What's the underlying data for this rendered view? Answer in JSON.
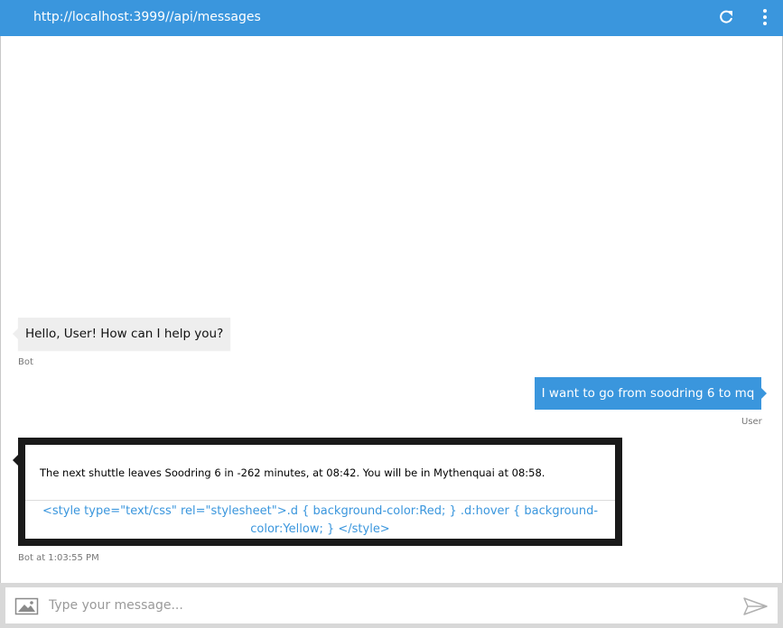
{
  "header": {
    "url": "http://localhost:3999//api/messages",
    "refresh_icon": "refresh-icon",
    "menu_icon": "more-vertical-icon"
  },
  "messages": [
    {
      "sender": "bot",
      "text": "Hello, User! How can I help you?",
      "meta": "Bot"
    },
    {
      "sender": "user",
      "text": "I want to go from soodring 6 to mq",
      "meta": "User"
    },
    {
      "sender": "bot",
      "card_text": "The next shuttle leaves Soodring 6 in -262 minutes, at 08:42. You will be in Mythenquai at 08:58.",
      "card_button": "<style type=\"text/css\" rel=\"stylesheet\">.d { background-color:Red; } .d:hover { background-color:Yellow; } </style>",
      "meta": "Bot at 1:03:55 PM"
    }
  ],
  "input": {
    "placeholder": "Type your message...",
    "value": "",
    "image_icon": "image-upload-icon",
    "send_icon": "send-icon"
  },
  "colors": {
    "accent": "#3a96dd",
    "bot_bubble": "#eeeeee",
    "card_border": "#1a1a1a",
    "input_bar": "#d8d8d8"
  }
}
